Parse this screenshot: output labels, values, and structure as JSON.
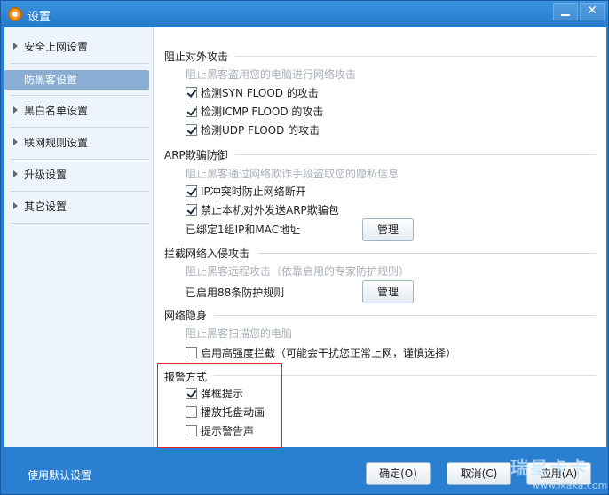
{
  "window": {
    "title": "设置",
    "minimize_icon": "minimize-icon",
    "close_icon": "close-icon",
    "close_glyph": "✕"
  },
  "sidebar": {
    "items": [
      {
        "label": "安全上网设置",
        "active": false
      },
      {
        "label": "防黑客设置",
        "active": true
      },
      {
        "label": "黑白名单设置",
        "active": false
      },
      {
        "label": "联网规则设置",
        "active": false
      },
      {
        "label": "升级设置",
        "active": false
      },
      {
        "label": "其它设置",
        "active": false
      }
    ]
  },
  "sections": {
    "external_attack": {
      "title": "阻止对外攻击",
      "description": "阻止黑客盗用您的电脑进行网络攻击",
      "options": [
        {
          "label": "检测SYN  FLOOD 的攻击",
          "checked": true
        },
        {
          "label": "检测ICMP  FLOOD 的攻击",
          "checked": true
        },
        {
          "label": "检测UDP  FLOOD 的攻击",
          "checked": true
        }
      ]
    },
    "arp": {
      "title": "ARP欺骗防御",
      "description": "阻止黑客通过网络欺诈手段盗取您的隐私信息",
      "options": [
        {
          "label": "IP冲突时防止网络断开",
          "checked": true
        },
        {
          "label": "禁止本机对外发送ARP欺骗包",
          "checked": true
        }
      ],
      "bound_info": "已绑定1组IP和MAC地址",
      "manage_label": "管理"
    },
    "intrusion": {
      "title": "拦截网络入侵攻击",
      "description": "阻止黑客远程攻击（依靠启用的专家防护规则）",
      "rules_info": "已启用88条防护规则",
      "manage_label": "管理"
    },
    "stealth": {
      "title": "网络隐身",
      "description": "阻止黑客扫描您的电脑",
      "options": [
        {
          "label": "启用高强度拦截（可能会干扰您正常上网，谨慎选择）",
          "checked": false
        }
      ]
    },
    "alert": {
      "title": "报警方式",
      "options": [
        {
          "label": "弹框提示",
          "checked": true
        },
        {
          "label": "播放托盘动画",
          "checked": false
        },
        {
          "label": "提示警告声",
          "checked": false
        }
      ]
    }
  },
  "footer": {
    "defaults_label": "使用默认设置",
    "ok_label": "确定(O)",
    "cancel_label": "取消(C)",
    "apply_label": "应用(A)"
  },
  "watermark": {
    "line1": "瑞星卡卡",
    "line2": "www.ikaka.com"
  },
  "colors": {
    "title_bar": "#2a7fd0",
    "sidebar_bg": "#eef4fb",
    "active_item": "#8aaed3",
    "highlight_box": "#e02525",
    "description_text": "#a8b0b8"
  }
}
